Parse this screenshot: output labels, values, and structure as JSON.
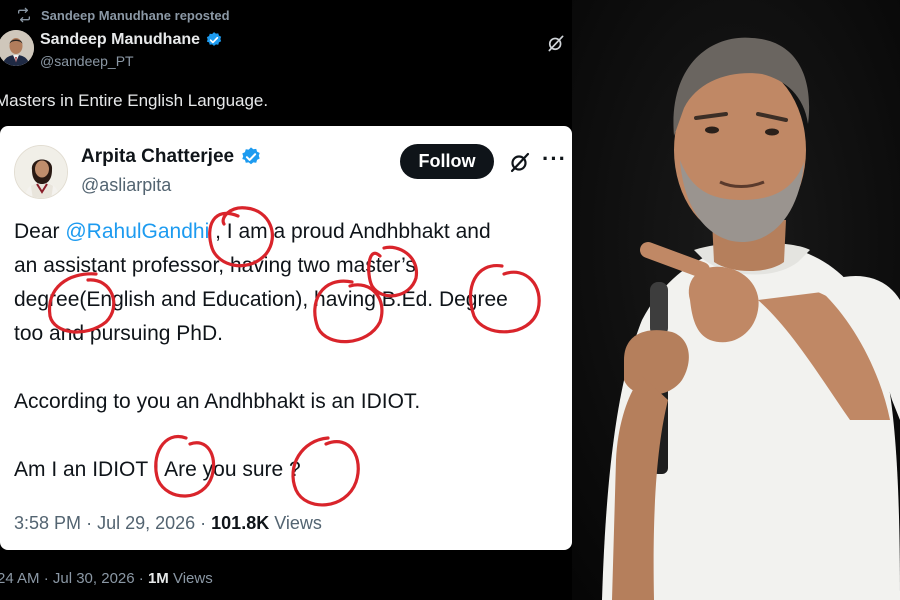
{
  "outer_tweet": {
    "repost_label": "Sandeep Manudhane reposted",
    "author_name": "Sandeep Manudhane",
    "author_handle": "@sandeep_PT",
    "text": "Masters in Entire English Language.",
    "time": "24 AM",
    "date": "Jul 30, 2026",
    "views_count": "1M",
    "views_label": "Views"
  },
  "quoted_tweet": {
    "author_name": "Arpita Chatterjee",
    "author_handle": "@asliarpita",
    "follow_label": "Follow",
    "more_label": "···",
    "body": {
      "l1_prefix": "Dear ",
      "l1_mention": "@RahulGandhi",
      "l1_suffix": " , I am a proud Andhbhakt and",
      "l2": "an assistant professor, having two master’s",
      "l3": "degree(English and Education), having B.Ed. Degree",
      "l4": "too and pursuing PhD.",
      "l5": "According to you an Andhbhakt is an IDIOT.",
      "l6": "Am I an IDIOT ! Are you sure ?"
    },
    "time": "3:58 PM",
    "date": "Jul 29, 2026",
    "views_count": "101.8K",
    "views_label": "Views",
    "annotation_color": "#d9242b"
  },
  "colors": {
    "verified": "#1d9bf0",
    "link": "#1d9bf0",
    "dark_bg": "#000000",
    "shirt": "#f2f2ef"
  },
  "icons": [
    "repost-icon",
    "verified-badge-icon",
    "grok-icon",
    "more-icon"
  ]
}
